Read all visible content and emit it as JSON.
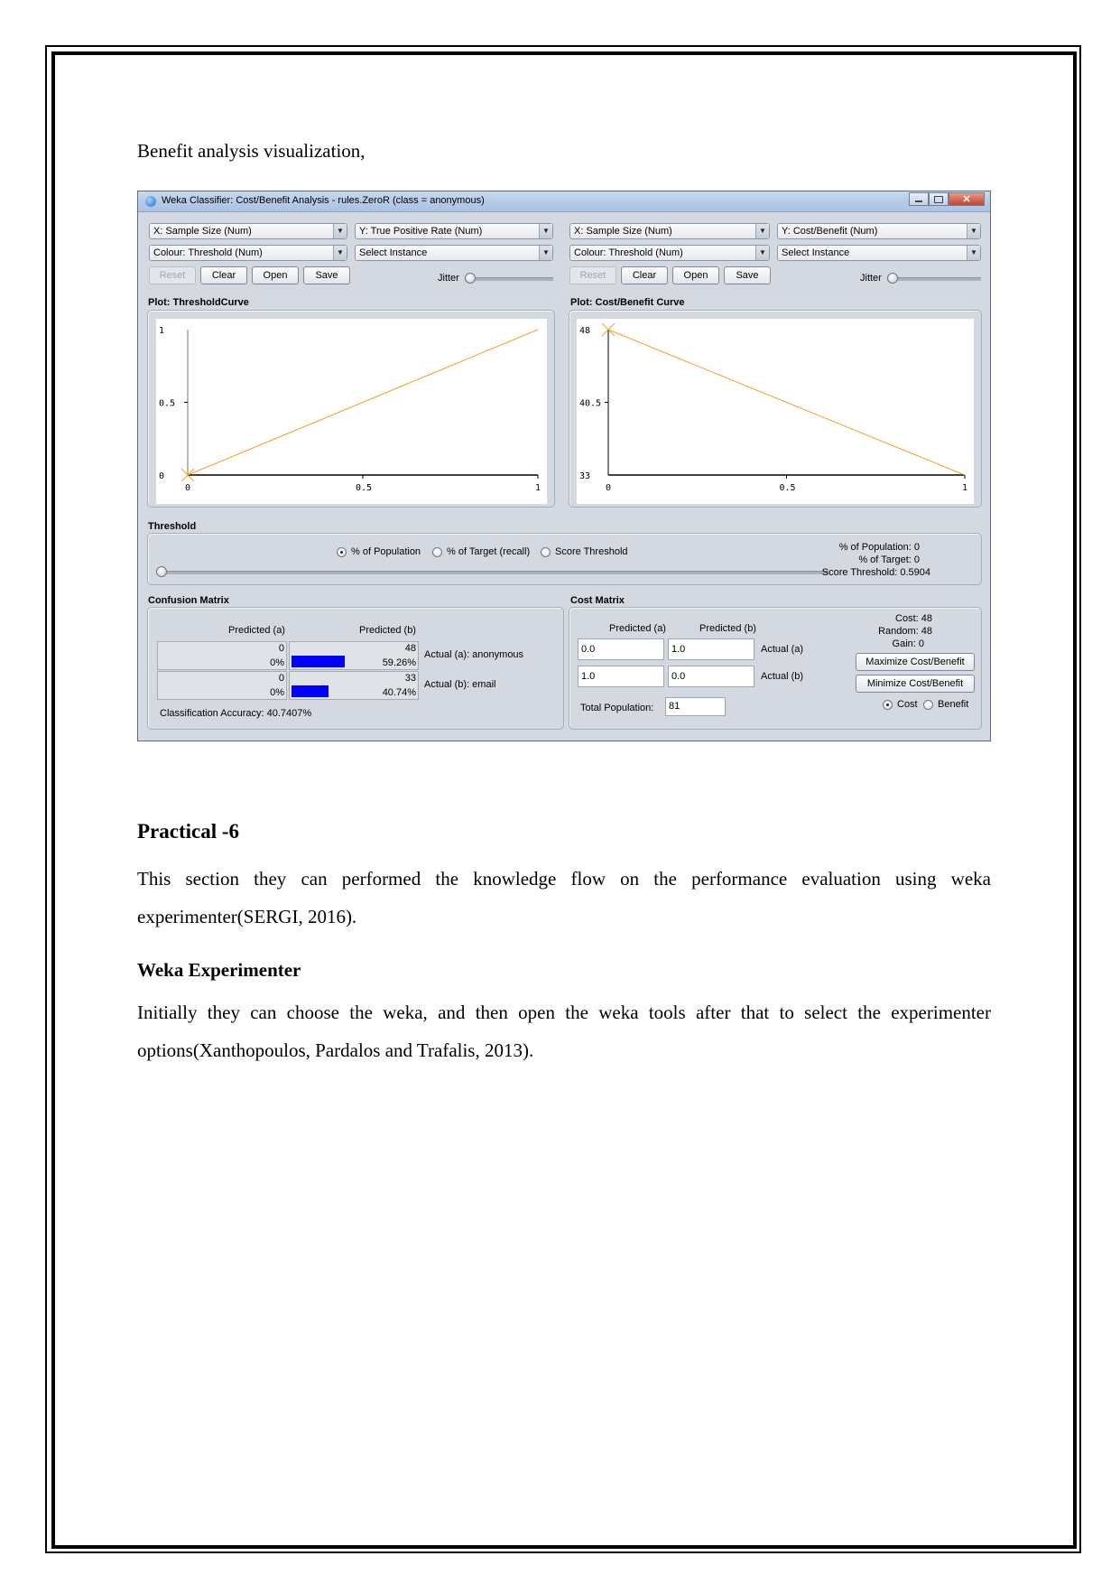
{
  "document": {
    "intro": "Benefit analysis visualization,",
    "heading_practical": "Practical -6",
    "para1": "This section they can performed the knowledge flow on the performance evaluation using weka experimenter(SERGI, 2016).",
    "heading_weka": "Weka Experimenter",
    "para2": "Initially they can choose the weka, and then open the weka tools after that to select the experimenter options(Xanthopoulos, Pardalos and Trafalis, 2013)."
  },
  "window": {
    "title": "Weka Classifier: Cost/Benefit Analysis - rules.ZeroR  (class = anonymous)",
    "icons": {
      "app": "weka-icon",
      "minimize": "minimize-icon",
      "maximize": "maximize-icon",
      "close": "close-icon"
    },
    "close_glyph": "✕",
    "left_panel": {
      "x_axis": "X: Sample Size (Num)",
      "y_axis": "Y: True Positive Rate (Num)",
      "colour": "Colour: Threshold (Num)",
      "select_instance": "Select Instance",
      "buttons": {
        "reset": "Reset",
        "clear": "Clear",
        "open": "Open",
        "save": "Save"
      },
      "jitter": "Jitter",
      "plot_title": "Plot: ThresholdCurve"
    },
    "right_panel": {
      "x_axis": "X: Sample Size (Num)",
      "y_axis": "Y: Cost/Benefit (Num)",
      "colour": "Colour: Threshold (Num)",
      "select_instance": "Select Instance",
      "buttons": {
        "reset": "Reset",
        "clear": "Clear",
        "open": "Open",
        "save": "Save"
      },
      "jitter": "Jitter",
      "plot_title": "Plot: Cost/Benefit Curve"
    },
    "threshold": {
      "title": "Threshold",
      "options": [
        {
          "label": "% of Population",
          "selected": true
        },
        {
          "label": "% of Target (recall)",
          "selected": false
        },
        {
          "label": "Score Threshold",
          "selected": false
        }
      ],
      "slider_value": 0,
      "pct_population": "% of Population: 0",
      "pct_target": "% of Target: 0",
      "score_threshold": "Score Threshold: 0.5904"
    },
    "confusion_matrix": {
      "title": "Confusion Matrix",
      "col_headers": [
        "Predicted (a)",
        "Predicted (b)"
      ],
      "rows": [
        {
          "label": "Actual (a): anonymous",
          "cells": [
            {
              "count": "0",
              "pct": "0%",
              "fraction": 0
            },
            {
              "count": "48",
              "pct": "59.26%",
              "fraction": 0.5926
            }
          ]
        },
        {
          "label": "Actual (b): email",
          "cells": [
            {
              "count": "0",
              "pct": "0%",
              "fraction": 0
            },
            {
              "count": "33",
              "pct": "40.74%",
              "fraction": 0.4074
            }
          ]
        }
      ],
      "accuracy": "Classification Accuracy:  40.7407%"
    },
    "cost_matrix": {
      "title": "Cost Matrix",
      "col_headers": [
        "Predicted (a)",
        "Predicted (b)"
      ],
      "rows": [
        {
          "label": "Actual (a)",
          "values": [
            "0.0",
            "1.0"
          ]
        },
        {
          "label": "Actual (b)",
          "values": [
            "1.0",
            "0.0"
          ]
        }
      ],
      "total_population_label": "Total Population:",
      "total_population": "81",
      "cost": "Cost: 48",
      "random": "Random: 48",
      "gain": "Gain: 0",
      "maximize": "Maximize Cost/Benefit",
      "minimize": "Minimize Cost/Benefit",
      "mode_options": [
        {
          "label": "Cost",
          "selected": true
        },
        {
          "label": "Benefit",
          "selected": false
        }
      ]
    }
  },
  "chart_data": [
    {
      "type": "line",
      "title": "Plot: ThresholdCurve",
      "xlabel": "Sample Size",
      "ylabel": "True Positive Rate",
      "x": [
        0,
        1
      ],
      "series": [
        {
          "name": "ThresholdCurve",
          "values": [
            0,
            1
          ],
          "color": "#f0a020"
        }
      ],
      "xticks": [
        "0",
        "0.5",
        "1"
      ],
      "yticks": [
        "0",
        "0.5",
        "1"
      ],
      "xlim": [
        0,
        1
      ],
      "ylim": [
        0,
        1
      ],
      "grid": false
    },
    {
      "type": "line",
      "title": "Plot: Cost/Benefit Curve",
      "xlabel": "Sample Size",
      "ylabel": "Cost/Benefit",
      "x": [
        0,
        1
      ],
      "series": [
        {
          "name": "Cost/Benefit",
          "values": [
            48,
            33
          ],
          "color": "#f0a020"
        }
      ],
      "xticks": [
        "0",
        "0.5",
        "1"
      ],
      "yticks": [
        "33",
        "40.5",
        "48"
      ],
      "xlim": [
        0,
        1
      ],
      "ylim": [
        33,
        48
      ],
      "grid": false
    }
  ]
}
